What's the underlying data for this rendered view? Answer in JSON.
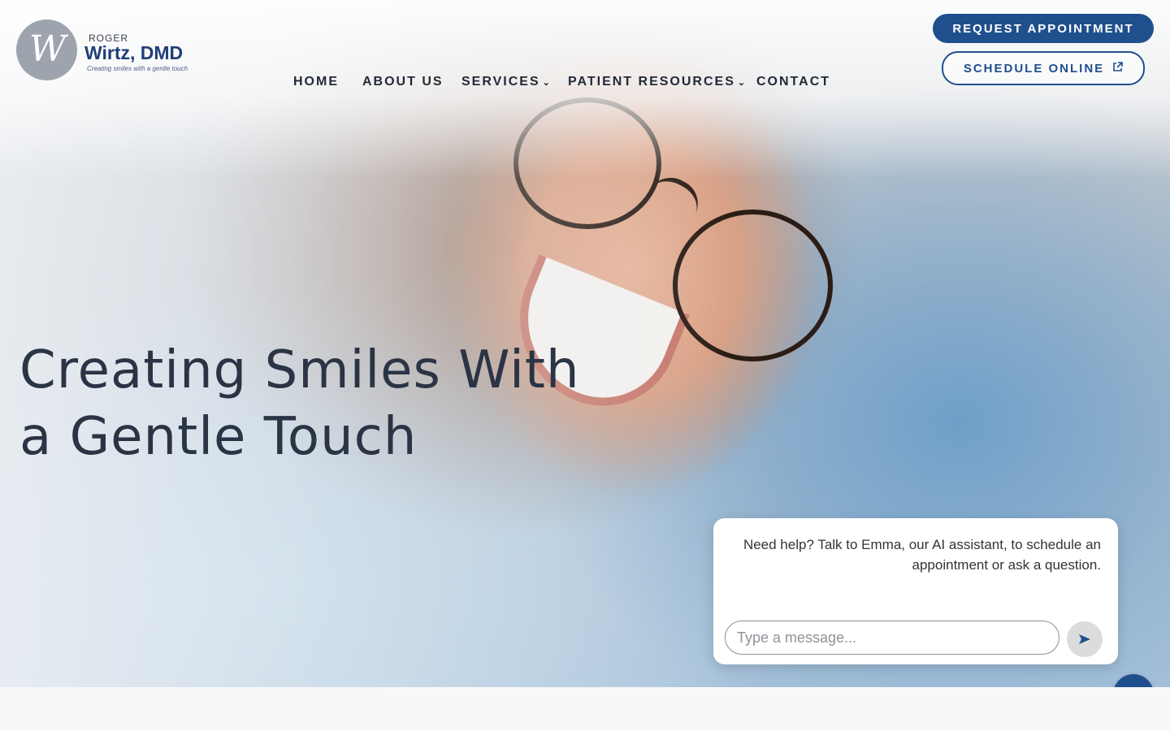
{
  "brand": {
    "logo_first": "ROGER",
    "logo_name": "Wirtz, DMD",
    "logo_tagline": "Creating smiles with a gentle touch",
    "primary_color": "#1f4f8d"
  },
  "nav": {
    "items": [
      {
        "label": "HOME"
      },
      {
        "label": "ABOUT US"
      },
      {
        "label": "SERVICES",
        "has_dropdown": true
      },
      {
        "label": "PATIENT RESOURCES",
        "has_dropdown": true
      },
      {
        "label": "CONTACT"
      }
    ]
  },
  "cta": {
    "request_label": "REQUEST APPOINTMENT",
    "schedule_label": "SCHEDULE ONLINE",
    "schedule_icon": "external-link-icon"
  },
  "hero": {
    "line1": "Creating Smiles With",
    "line2": "a Gentle Touch"
  },
  "chat": {
    "message": "Need help? Talk to Emma, our AI assistant, to schedule an appointment or ask a question.",
    "input_placeholder": "Type a message...",
    "send_icon": "send-icon",
    "close_icon": "close-icon"
  }
}
